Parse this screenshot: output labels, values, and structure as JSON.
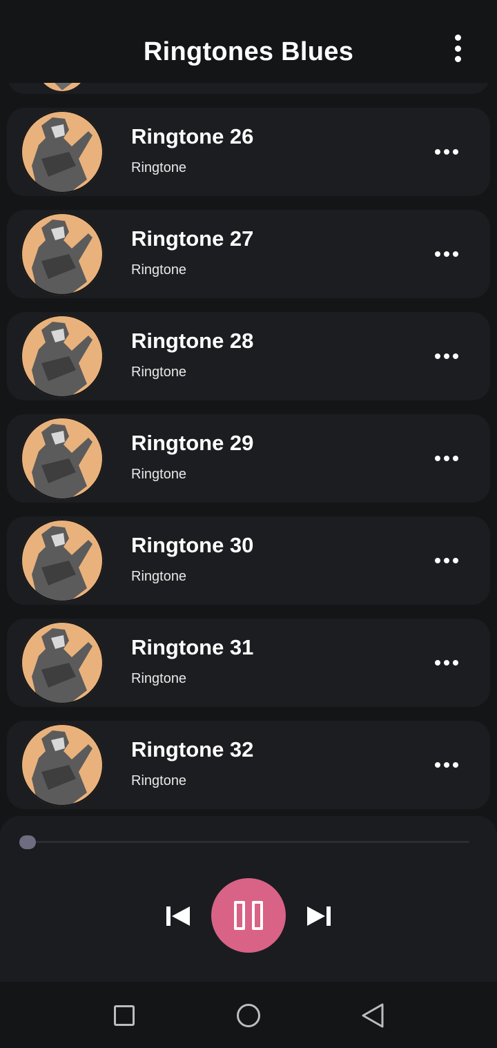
{
  "app": {
    "title": "Ringtones Blues",
    "menu_icon": "more-vert-icon"
  },
  "list": {
    "items": [
      {
        "title": "Ringtone 26",
        "subtitle": "Ringtone"
      },
      {
        "title": "Ringtone 27",
        "subtitle": "Ringtone"
      },
      {
        "title": "Ringtone 28",
        "subtitle": "Ringtone"
      },
      {
        "title": "Ringtone 29",
        "subtitle": "Ringtone"
      },
      {
        "title": "Ringtone 30",
        "subtitle": "Ringtone"
      },
      {
        "title": "Ringtone 31",
        "subtitle": "Ringtone"
      },
      {
        "title": "Ringtone 32",
        "subtitle": "Ringtone"
      }
    ]
  },
  "player": {
    "progress": 0.0,
    "state": "playing",
    "accent_color": "#d96287"
  },
  "colors": {
    "background": "#141517",
    "card": "#1c1d20",
    "thumb_background": "#e9b27c"
  }
}
